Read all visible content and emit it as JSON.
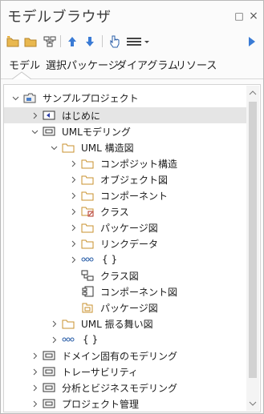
{
  "window": {
    "title": "モデルブラウザ"
  },
  "titlebar": {
    "pin_glyph": "□",
    "close_glyph": "×"
  },
  "tabs": [
    {
      "label": "モデル",
      "active": true
    },
    {
      "label": "選択パッケージ",
      "active": false
    },
    {
      "label": "ダイアグラム",
      "active": false
    },
    {
      "label": "リソース",
      "active": false
    }
  ],
  "tree": {
    "root": "サンプルプロジェクト",
    "nodes": [
      {
        "label": "はじめに"
      },
      {
        "label": "UMLモデリング"
      },
      {
        "label": "UML 構造図"
      },
      {
        "label": "コンポジット構造"
      },
      {
        "label": "オブジェクト図"
      },
      {
        "label": "コンポーネント"
      },
      {
        "label": "クラス"
      },
      {
        "label": "パッケージ図"
      },
      {
        "label": "リンクデータ"
      },
      {
        "label": "{ }"
      },
      {
        "label": "クラス図"
      },
      {
        "label": "コンポーネント図"
      },
      {
        "label": "パッケージ図"
      },
      {
        "label": "UML 振る舞い図"
      },
      {
        "label": "{ }"
      },
      {
        "label": "ドメイン固有のモデリング"
      },
      {
        "label": "トレーサビリティ"
      },
      {
        "label": "分析とビジネスモデリング"
      },
      {
        "label": "プロジェクト管理"
      }
    ]
  },
  "colors": {
    "folder": "#d9a441",
    "package_border": "#555555",
    "accent_blue": "#3a7bd5",
    "selected_row": "#e5e5e5"
  }
}
